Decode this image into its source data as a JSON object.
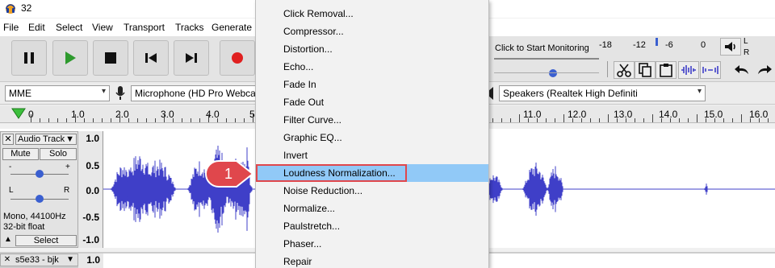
{
  "window": {
    "title": "32"
  },
  "menubar": {
    "items": [
      "File",
      "Edit",
      "Select",
      "View",
      "Transport",
      "Tracks",
      "Generate"
    ]
  },
  "meter": {
    "monitor_label": "Click to Start Monitoring",
    "scale": [
      "-18",
      "-12",
      "-6",
      "0"
    ],
    "channels": [
      "L",
      "R"
    ]
  },
  "devices": {
    "host": "MME",
    "microphone": "Microphone (HD Pro Webca",
    "speakers": "Speakers (Realtek High Definiti"
  },
  "ruler": {
    "labels": [
      "0",
      "1.0",
      "2.0",
      "3.0",
      "4.0",
      "5",
      "11.0",
      "12.0",
      "13.0",
      "14.0",
      "15.0",
      "16.0"
    ]
  },
  "track": {
    "name": "Audio Track",
    "mute_label": "Mute",
    "solo_label": "Solo",
    "pan_left": "L",
    "pan_right": "R",
    "info_line1": "Mono, 44100Hz",
    "info_line2": "32-bit float",
    "select_label": "Select",
    "scale": [
      "1.0",
      "0.5",
      "0.0",
      "-0.5",
      "-1.0"
    ]
  },
  "track2": {
    "name": "s5e33 - bjk",
    "scale_top": "1.0"
  },
  "effect_menu": {
    "items": [
      "Click Removal...",
      "Compressor...",
      "Distortion...",
      "Echo...",
      "Fade In",
      "Fade Out",
      "Filter Curve...",
      "Graphic EQ...",
      "Invert",
      "Loudness Normalization...",
      "Noise Reduction...",
      "Normalize...",
      "Paulstretch...",
      "Phaser...",
      "Repair"
    ],
    "highlighted_index": 9
  },
  "callout": {
    "number": "1"
  },
  "colors": {
    "waveform": "#3f3fc8",
    "highlight": "#91c9f7",
    "callout": "#e0474c"
  }
}
